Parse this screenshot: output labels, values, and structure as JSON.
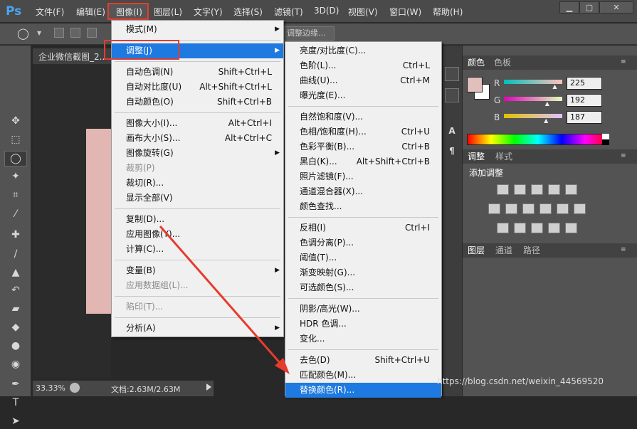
{
  "app": {
    "logo": "Ps"
  },
  "menubar": [
    {
      "id": "file",
      "label": "文件(F)"
    },
    {
      "id": "edit",
      "label": "编辑(E)"
    },
    {
      "id": "image",
      "label": "图像(I)"
    },
    {
      "id": "layer",
      "label": "图层(L)"
    },
    {
      "id": "type",
      "label": "文字(Y)"
    },
    {
      "id": "select",
      "label": "选择(S)"
    },
    {
      "id": "filter",
      "label": "滤镜(T)"
    },
    {
      "id": "3d",
      "label": "3D(D)"
    },
    {
      "id": "view",
      "label": "视图(V)"
    },
    {
      "id": "window",
      "label": "窗口(W)"
    },
    {
      "id": "help",
      "label": "帮助(H)"
    }
  ],
  "window_buttons": {
    "minimize": "▁",
    "restore": "▢",
    "close": "✕"
  },
  "options_bar": {
    "refine_edge": "调整边缘..."
  },
  "document": {
    "tab_title": "企业微信截图_2...",
    "zoom": "33.33%",
    "doc_info": "文档:2.63M/2.63M"
  },
  "image_menu": [
    {
      "label": "模式(M)",
      "arrow": true
    },
    {
      "sep": true
    },
    {
      "label": "调整(J)",
      "arrow": true,
      "highlight": true
    },
    {
      "sep": true
    },
    {
      "label": "自动色调(N)",
      "shortcut": "Shift+Ctrl+L"
    },
    {
      "label": "自动对比度(U)",
      "shortcut": "Alt+Shift+Ctrl+L"
    },
    {
      "label": "自动颜色(O)",
      "shortcut": "Shift+Ctrl+B"
    },
    {
      "sep": true
    },
    {
      "label": "图像大小(I)...",
      "shortcut": "Alt+Ctrl+I"
    },
    {
      "label": "画布大小(S)...",
      "shortcut": "Alt+Ctrl+C"
    },
    {
      "label": "图像旋转(G)",
      "arrow": true
    },
    {
      "label": "裁剪(P)",
      "disabled": true
    },
    {
      "label": "裁切(R)..."
    },
    {
      "label": "显示全部(V)"
    },
    {
      "sep": true
    },
    {
      "label": "复制(D)..."
    },
    {
      "label": "应用图像(Y)..."
    },
    {
      "label": "计算(C)..."
    },
    {
      "sep": true
    },
    {
      "label": "变量(B)",
      "arrow": true
    },
    {
      "label": "应用数据组(L)...",
      "disabled": true
    },
    {
      "sep": true
    },
    {
      "label": "陷印(T)...",
      "disabled": true
    },
    {
      "sep": true
    },
    {
      "label": "分析(A)",
      "arrow": true
    }
  ],
  "adjust_menu": [
    {
      "label": "亮度/对比度(C)..."
    },
    {
      "label": "色阶(L)...",
      "shortcut": "Ctrl+L"
    },
    {
      "label": "曲线(U)...",
      "shortcut": "Ctrl+M"
    },
    {
      "label": "曝光度(E)..."
    },
    {
      "sep": true
    },
    {
      "label": "自然饱和度(V)..."
    },
    {
      "label": "色相/饱和度(H)...",
      "shortcut": "Ctrl+U"
    },
    {
      "label": "色彩平衡(B)...",
      "shortcut": "Ctrl+B"
    },
    {
      "label": "黑白(K)...",
      "shortcut": "Alt+Shift+Ctrl+B"
    },
    {
      "label": "照片滤镜(F)..."
    },
    {
      "label": "通道混合器(X)..."
    },
    {
      "label": "颜色查找..."
    },
    {
      "sep": true
    },
    {
      "label": "反相(I)",
      "shortcut": "Ctrl+I"
    },
    {
      "label": "色调分离(P)..."
    },
    {
      "label": "阈值(T)..."
    },
    {
      "label": "渐变映射(G)..."
    },
    {
      "label": "可选颜色(S)..."
    },
    {
      "sep": true
    },
    {
      "label": "阴影/高光(W)..."
    },
    {
      "label": "HDR 色调..."
    },
    {
      "label": "变化..."
    },
    {
      "sep": true
    },
    {
      "label": "去色(D)",
      "shortcut": "Shift+Ctrl+U"
    },
    {
      "label": "匹配颜色(M)..."
    },
    {
      "label": "替换颜色(R)...",
      "highlight": true
    }
  ],
  "color_panel": {
    "tabs": [
      "颜色",
      "色板"
    ],
    "channels": [
      {
        "name": "R",
        "value": "225",
        "pos": 0.882
      },
      {
        "name": "G",
        "value": "192",
        "pos": 0.753
      },
      {
        "name": "B",
        "value": "187",
        "pos": 0.733
      }
    ],
    "swatch": "#e1c0bb"
  },
  "adjustments_panel": {
    "tabs": [
      "调整",
      "样式"
    ],
    "title": "添加调整"
  },
  "layers_panel": {
    "tabs": [
      "图层",
      "通道",
      "路径"
    ]
  },
  "watermark": "https://blog.csdn.net/weixin_44569520",
  "colors": {
    "accent": "#e53c2e",
    "highlight": "#1e7ae0"
  }
}
